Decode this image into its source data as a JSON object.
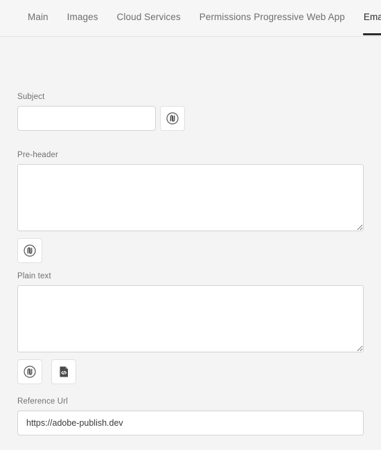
{
  "tabs": [
    {
      "label": "Main",
      "selected": false
    },
    {
      "label": "Images",
      "selected": false
    },
    {
      "label": "Cloud Services",
      "selected": false
    },
    {
      "label": "Permissions",
      "selected": false
    },
    {
      "label": "Progressive Web App",
      "selected": false
    },
    {
      "label": "Email",
      "selected": true
    }
  ],
  "fields": {
    "subject": {
      "label": "Subject",
      "value": "",
      "placeholder": ""
    },
    "preheader": {
      "label": "Pre-header",
      "value": "",
      "placeholder": ""
    },
    "plaintext": {
      "label": "Plain text",
      "value": "",
      "placeholder": ""
    },
    "reference_url": {
      "label": "Reference Url",
      "value": "https://adobe-publish.dev",
      "placeholder": ""
    }
  },
  "icons": {
    "personalization": "personalization-icon",
    "source_code": "source-code-icon"
  },
  "colors": {
    "page_background": "#f4f4f4",
    "tabbar_background": "#f6f6f6",
    "selected_tab_underline": "#2b2b2b",
    "input_border": "#d3d3d3",
    "input_background": "#ffffff",
    "label_text": "#707070",
    "tab_text": "#6d6d6d"
  }
}
